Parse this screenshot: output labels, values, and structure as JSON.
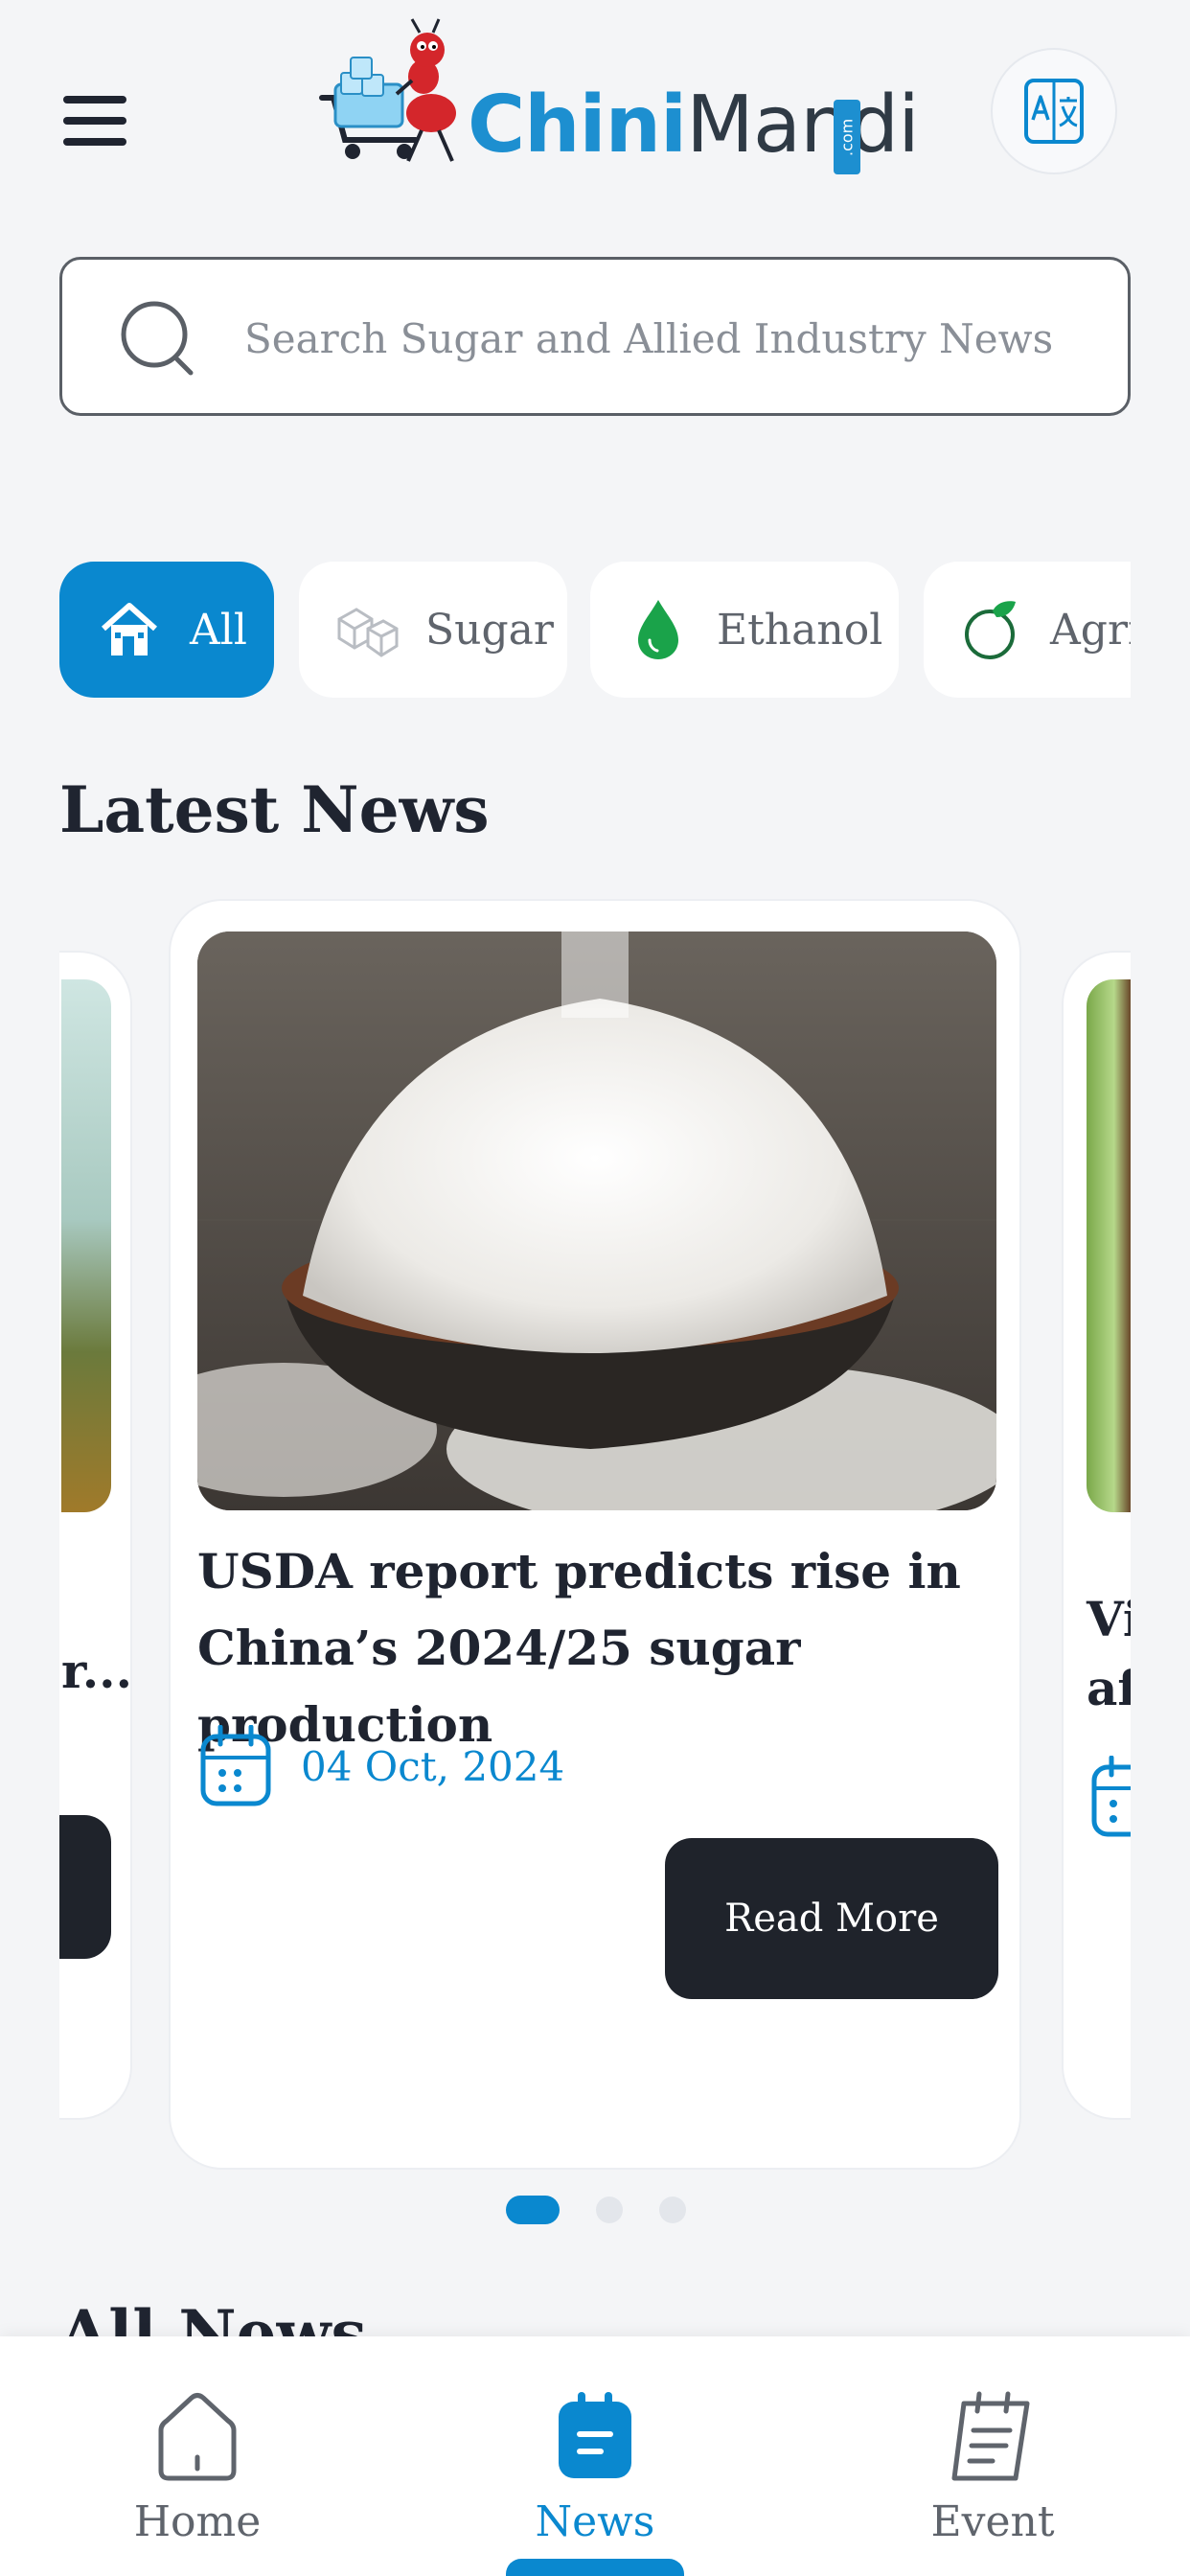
{
  "header": {
    "logo_text_chini": "Chini",
    "logo_text_mandi": "Mandi",
    "logo_text_com": ".com",
    "menu_icon": "hamburger-menu-icon",
    "translate_icon": "translate-icon"
  },
  "search": {
    "placeholder": "Search Sugar and Allied Industry News",
    "value": ""
  },
  "categories": [
    {
      "label": "All",
      "icon": "home-icon",
      "active": true
    },
    {
      "label": "Sugar",
      "icon": "sugar-cubes-icon",
      "active": false
    },
    {
      "label": "Ethanol",
      "icon": "drop-icon",
      "active": false
    },
    {
      "label": "Agri-",
      "icon": "leaf-icon",
      "active": false
    }
  ],
  "latest_news": {
    "title": "Latest News",
    "cards": {
      "prev": {
        "title_fragment": "r..."
      },
      "main": {
        "title": "USDA report predicts rise in China’s 2024/25 sugar production",
        "date": "04 Oct, 2024",
        "button": "Read More"
      },
      "next": {
        "title_fragment_1": "Vi",
        "title_fragment_2": "aft"
      }
    },
    "pagination": {
      "total": 3,
      "active_index": 0
    }
  },
  "all_news": {
    "title": "All News"
  },
  "bottom_nav": {
    "items": [
      {
        "label": "Home",
        "icon": "home-outline-icon",
        "active": false
      },
      {
        "label": "News",
        "icon": "news-icon",
        "active": true
      },
      {
        "label": "Event",
        "icon": "event-icon",
        "active": false
      }
    ]
  },
  "colors": {
    "accent": "#0a88cf",
    "dark_button": "#1f232b",
    "background": "#f4f5f7"
  }
}
